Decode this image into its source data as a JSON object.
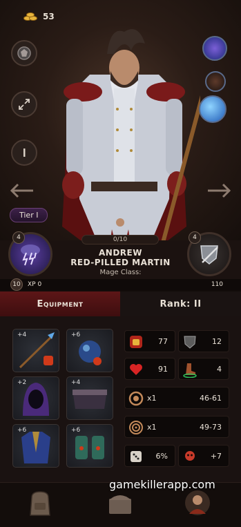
{
  "currency": {
    "amount": "53",
    "icon": "gold-coins-icon"
  },
  "side_buttons": [
    "emblem-icon",
    "expand-icon",
    "info-icon"
  ],
  "tier_label": "Tier I",
  "hero": {
    "first_name": "ANDREW",
    "last_name": "RED-PILLED MARTIN",
    "class_label": "Mage Class:",
    "progress": "0/10"
  },
  "skills": {
    "left_level": "4",
    "right_level": "4"
  },
  "xp": {
    "level": "10",
    "label": "XP 0",
    "max": "110"
  },
  "tabs": {
    "equipment": "Equipment",
    "rank": "Rank: II"
  },
  "equipment": [
    {
      "level": "+4",
      "item": "staff"
    },
    {
      "level": "+6",
      "item": "orb"
    },
    {
      "level": "+2",
      "item": "hood"
    },
    {
      "level": "+4",
      "item": "belt"
    },
    {
      "level": "+6",
      "item": "armor"
    },
    {
      "level": "+6",
      "item": "gloves"
    }
  ],
  "stats": {
    "attack": "77",
    "defense": "12",
    "health": "91",
    "speed": "4",
    "melee_mult": "x1",
    "melee_range": "46-61",
    "ranged_mult": "x1",
    "ranged_range": "49-73",
    "crit": "6%",
    "bonus": "+7"
  },
  "watermark": "gamekillerapp.com",
  "colors": {
    "accent_red": "#5c1617",
    "gold": "#e7b43c",
    "background": "#120c0a"
  }
}
